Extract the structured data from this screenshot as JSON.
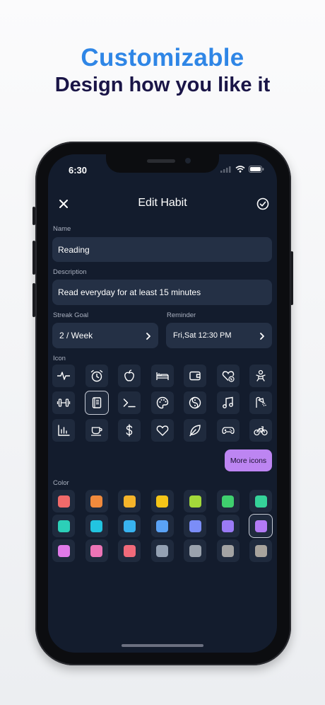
{
  "promo": {
    "title": "Customizable",
    "subtitle": "Design how you like it"
  },
  "status_bar": {
    "time": "6:30"
  },
  "header": {
    "title": "Edit Habit"
  },
  "form": {
    "name_label": "Name",
    "name_value": "Reading",
    "description_label": "Description",
    "description_value": "Read everyday for at least 15 minutes",
    "streak_goal_label": "Streak Goal",
    "streak_goal_value": "2 / Week",
    "reminder_label": "Reminder",
    "reminder_value": "Fri,Sat 12:30 PM",
    "icon_label": "Icon",
    "color_label": "Color"
  },
  "icons": [
    "heartbeat-icon",
    "alarm-clock-icon",
    "apple-icon",
    "bed-icon",
    "wallet-icon",
    "heart-badge-icon",
    "baby-icon",
    "dumbbell-icon",
    "book-icon",
    "terminal-icon",
    "palette-icon",
    "yin-yang-icon",
    "music-icon",
    "shower-icon",
    "bar-chart-icon",
    "coffee-cup-icon",
    "dollar-icon",
    "heart-icon",
    "leaf-icon",
    "gamepad-icon",
    "bicycle-icon"
  ],
  "selected_icon": "book-icon",
  "more_icons_label": "More icons",
  "colors": [
    "#f06a6a",
    "#f08a3c",
    "#f5b42a",
    "#f5c518",
    "#a3d93a",
    "#3fcf6e",
    "#35d399",
    "#2ccfb8",
    "#22c4e0",
    "#38b3f0",
    "#5aa2f5",
    "#7b8df7",
    "#9a7af5",
    "#b27af5",
    "#e07ae8",
    "#ec74b6",
    "#f06a7a",
    "#94a1b3",
    "#9aa2ad",
    "#a3a3a3",
    "#a8a49d"
  ],
  "selected_color": "#b27af5",
  "accent": "#bd85f2"
}
